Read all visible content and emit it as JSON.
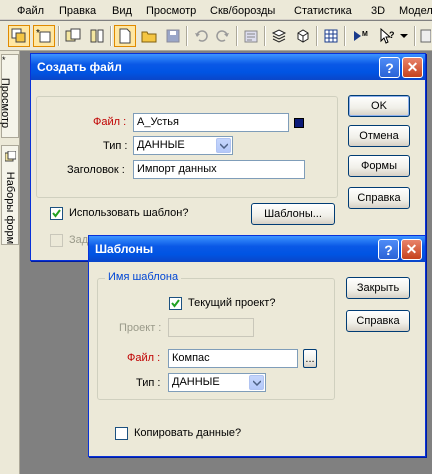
{
  "menubar": {
    "items": [
      "Файл",
      "Правка",
      "Вид",
      "Просмотр",
      "Скв/борозды",
      "Статистика",
      "3D",
      "Модел"
    ]
  },
  "side_tabs": {
    "preview": "Просмотр",
    "preview_marker": "*",
    "form_sets": "Наборы форм"
  },
  "create_dialog": {
    "title": "Создать файл",
    "file_label": "Файл :",
    "file_value": "А_Устья",
    "type_label": "Тип :",
    "type_value": "ДАННЫЕ",
    "header_label": "Заголовок :",
    "header_value": "Импорт данных",
    "use_template_label": "Использовать шаблон?",
    "use_template_checked": true,
    "partial_label": "Зад",
    "templates_button": "Шаблоны...",
    "ok": "OK",
    "cancel": "Отмена",
    "forms": "Формы",
    "help": "Справка",
    "swatch_color": "#0b1a78"
  },
  "templates_dialog": {
    "title": "Шаблоны",
    "group_label": "Имя шаблона",
    "current_project_label": "Текущий проект?",
    "current_project_checked": true,
    "project_label": "Проект :",
    "project_value": "",
    "file_label": "Файл :",
    "file_value": "Компас",
    "browse": "...",
    "type_label": "Тип :",
    "type_value": "ДАННЫЕ",
    "copy_data_label": "Копировать данные?",
    "copy_data_checked": false,
    "close": "Закрыть",
    "help": "Справка"
  }
}
